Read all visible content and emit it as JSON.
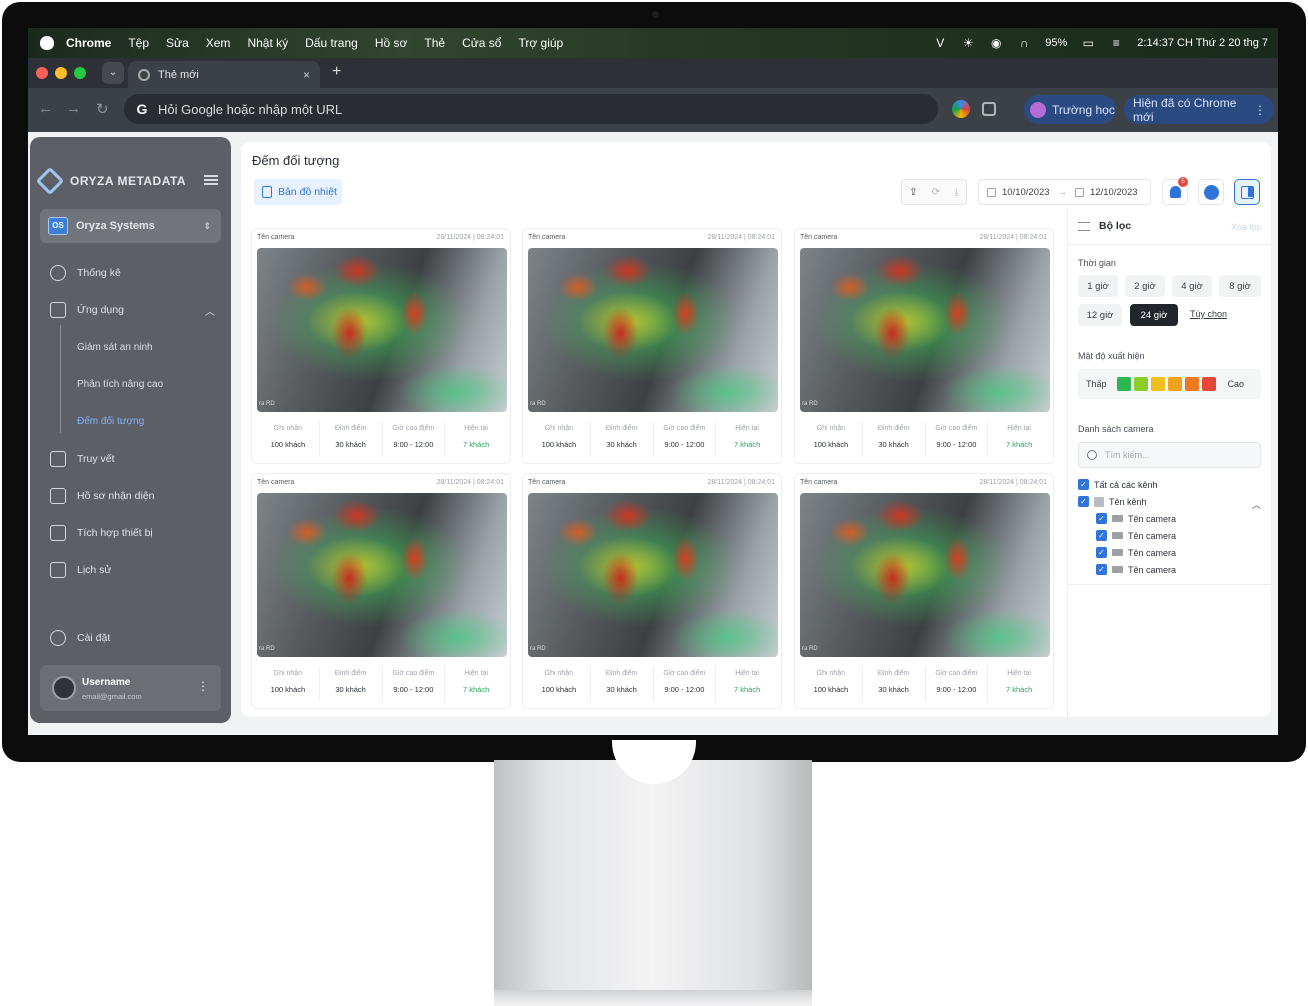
{
  "mac_menubar": {
    "app": "Chrome",
    "menus": [
      "Tệp",
      "Sửa",
      "Xem",
      "Nhật ký",
      "Dấu trang",
      "Hồ sơ",
      "Thẻ",
      "Cửa sổ",
      "Trợ giúp"
    ],
    "battery": "95%",
    "clock": "2:14:37 CH Thứ 2 20 thg 7"
  },
  "browser": {
    "tab_title": "Thẻ mới",
    "omnibox_placeholder": "Hỏi Google hoặc nhập một URL",
    "profile_label": "Trường học",
    "update_label": "Hiện đã có Chrome mới"
  },
  "sidebar": {
    "brand": "ORYZA METADATA",
    "org_badge": "OS",
    "org_name": "Oryza Systems",
    "menu": {
      "stats": "Thống kê",
      "apps": "Ứng dụng",
      "trace": "Truy vết",
      "profiles": "Hồ sơ nhận diện",
      "devices": "Tích hợp thiết bị",
      "history": "Lịch sử",
      "settings": "Cài đặt"
    },
    "submenu": [
      "Giám sát an ninh",
      "Phân tích nâng cao",
      "Đếm đối tượng"
    ],
    "user": {
      "name": "Username",
      "email": "email@gmail.com"
    }
  },
  "main": {
    "title": "Đếm đối tượng",
    "heatmap_button": "Bản đồ nhiệt",
    "date_from": "10/10/2023",
    "date_to": "12/10/2023",
    "notification_count": "5"
  },
  "stat_labels": [
    "Ghi nhận",
    "Đỉnh điểm",
    "Giờ cao điểm",
    "Hiện tại"
  ],
  "cards": [
    {
      "name": "Tên camera",
      "datetime": "28/11/2024 | 08:24:01",
      "watermark": "ra RD",
      "values": [
        "100 khách",
        "30 khách",
        "9:00 - 12:00",
        "7 khách"
      ]
    },
    {
      "name": "Tên camera",
      "datetime": "28/11/2024 | 08:24:01",
      "watermark": "ra RD",
      "values": [
        "100 khách",
        "30 khách",
        "9:00 - 12:00",
        "7 khách"
      ]
    },
    {
      "name": "Tên camera",
      "datetime": "28/11/2024 | 08:24:01",
      "watermark": "ra RD",
      "values": [
        "100 khách",
        "30 khách",
        "9:00 - 12:00",
        "7 khách"
      ]
    },
    {
      "name": "Tên camera",
      "datetime": "28/11/2024 | 08:24:01",
      "watermark": "ra RD",
      "values": [
        "100 khách",
        "30 khách",
        "9:00 - 12:00",
        "7 khách"
      ]
    },
    {
      "name": "Tên camera",
      "datetime": "28/11/2024 | 08:24:01",
      "watermark": "ra RD",
      "values": [
        "100 khách",
        "30 khách",
        "9:00 - 12:00",
        "7 khách"
      ]
    },
    {
      "name": "Tên camera",
      "datetime": "28/11/2024 | 08:24:01",
      "watermark": "ra RD",
      "values": [
        "100 khách",
        "30 khách",
        "9:00 - 12:00",
        "7 khách"
      ]
    }
  ],
  "filter": {
    "title": "Bộ lọc",
    "clear": "Xóa lọc",
    "time_label": "Thời gian",
    "time_options": [
      "1 giờ",
      "2 giờ",
      "4 giờ",
      "8 giờ",
      "12 giờ",
      "24 giờ"
    ],
    "time_selected": "24 giờ",
    "custom": "Tùy chọn",
    "density_label": "Mật độ xuất hiện",
    "density_low": "Thấp",
    "density_high": "Cao",
    "density_colors": [
      "#2db84d",
      "#8ccd2a",
      "#f2c01e",
      "#f3a21c",
      "#f0771f",
      "#e5463a"
    ],
    "camera_list_label": "Danh sách camera",
    "search_placeholder": "Tìm kiếm...",
    "all_channels": "Tất cả các kênh",
    "channel_name": "Tên kênh",
    "cameras": [
      "Tên camera",
      "Tên camera",
      "Tên camera",
      "Tên camera"
    ]
  }
}
